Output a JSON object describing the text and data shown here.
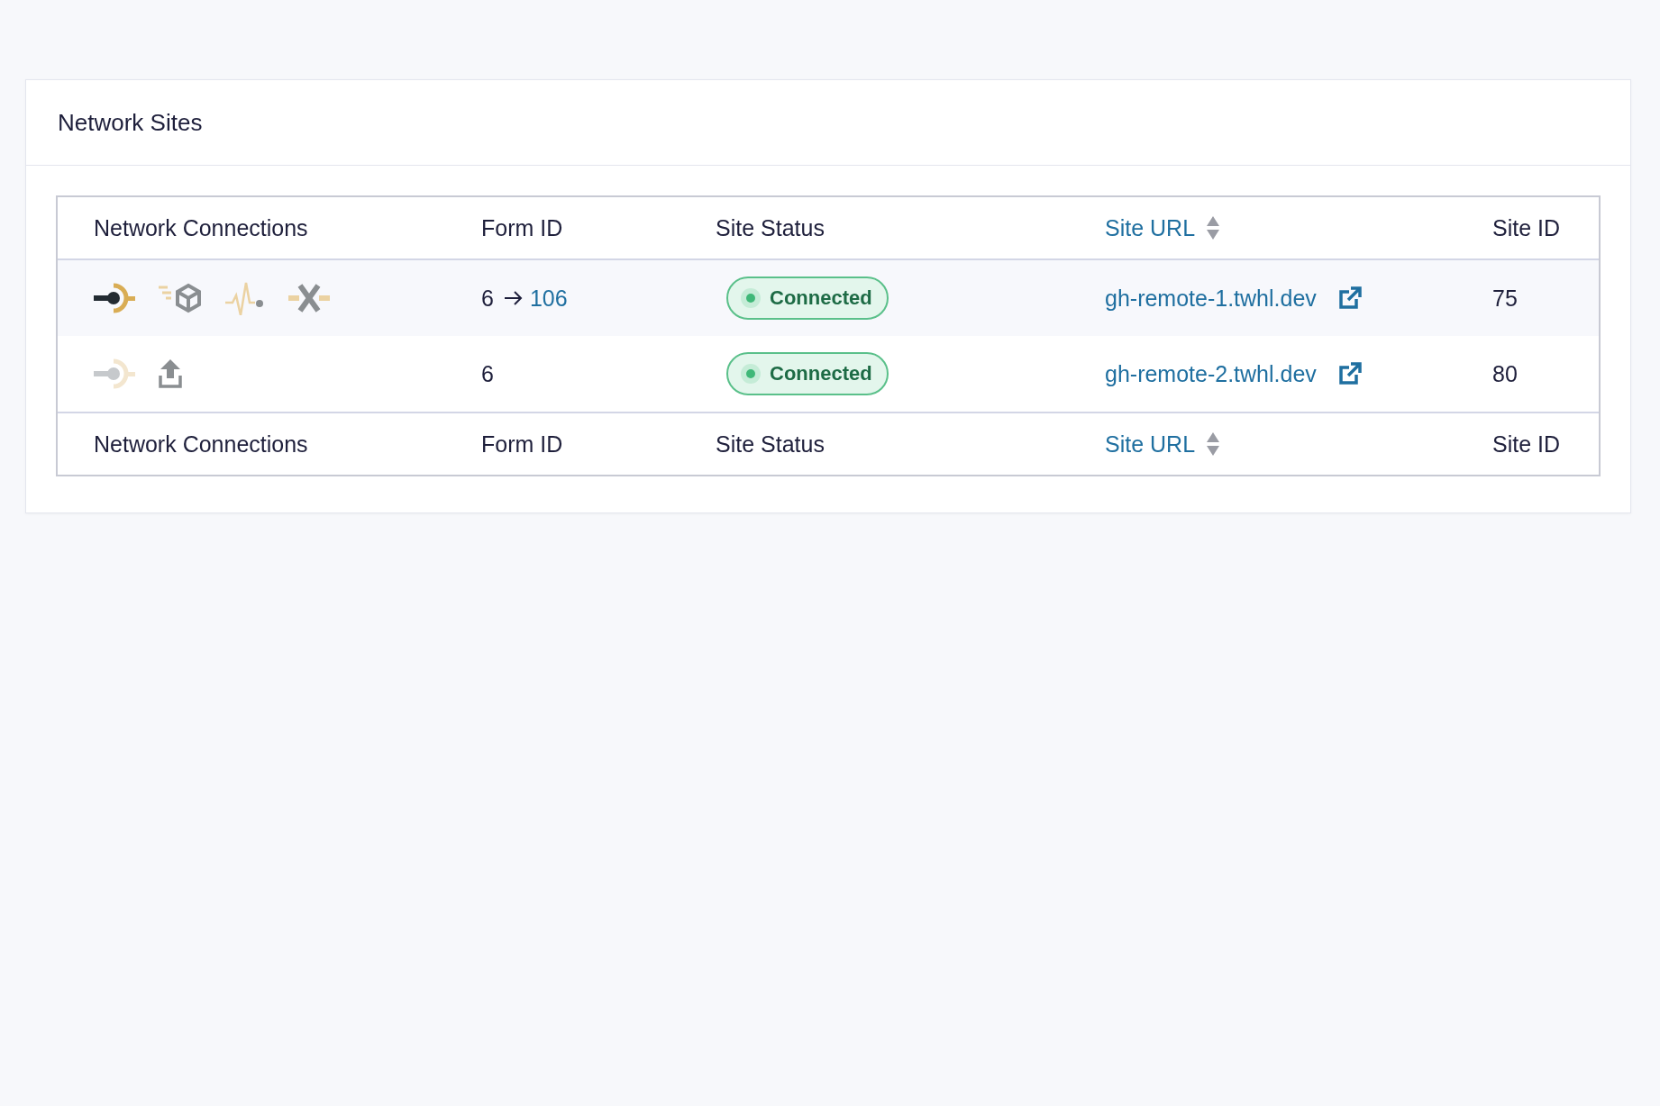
{
  "card": {
    "title": "Network Sites"
  },
  "table": {
    "columns": [
      {
        "label": "Network Connections",
        "sortable": false
      },
      {
        "label": "Form ID",
        "sortable": false
      },
      {
        "label": "Site Status",
        "sortable": false
      },
      {
        "label": "Site URL",
        "sortable": true
      },
      {
        "label": "Site ID",
        "sortable": false
      }
    ],
    "rows": [
      {
        "connections": [
          {
            "kind": "connector",
            "active": true
          },
          {
            "kind": "cube"
          },
          {
            "kind": "pulse"
          },
          {
            "kind": "cross"
          }
        ],
        "form_id": "6",
        "form_target": "106",
        "status": "Connected",
        "url": "gh-remote-1.twhl.dev",
        "site_id": "75"
      },
      {
        "connections": [
          {
            "kind": "connector",
            "active": false
          },
          {
            "kind": "upload"
          }
        ],
        "form_id": "6",
        "status": "Connected",
        "url": "gh-remote-2.twhl.dev",
        "site_id": "80"
      }
    ],
    "footer_columns": [
      {
        "label": "Network Connections",
        "sortable": false
      },
      {
        "label": "Form ID",
        "sortable": false
      },
      {
        "label": "Site Status",
        "sortable": false
      },
      {
        "label": "Site URL",
        "sortable": true
      },
      {
        "label": "Site ID",
        "sortable": false
      }
    ]
  }
}
